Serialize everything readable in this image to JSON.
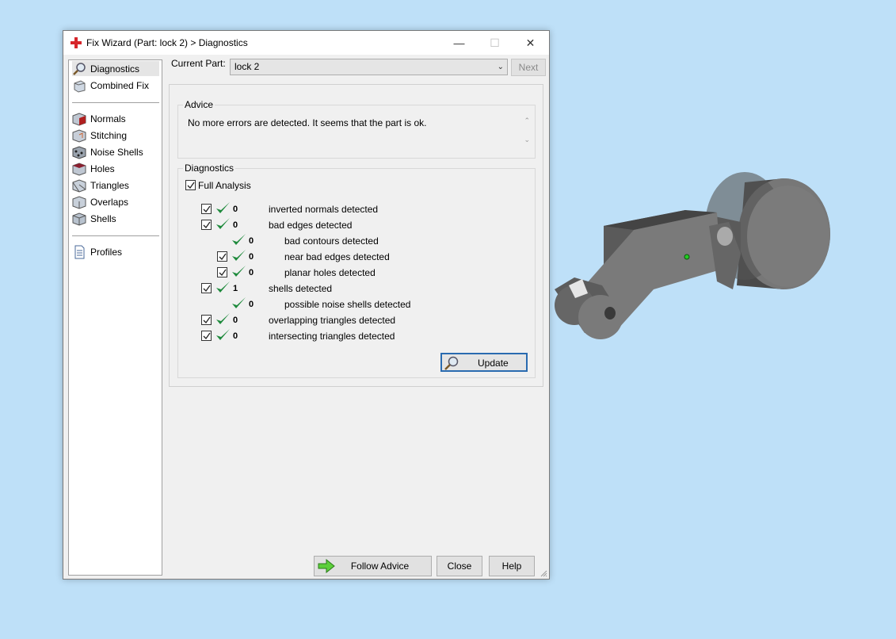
{
  "window": {
    "title": "Fix Wizard (Part: lock 2) > Diagnostics",
    "minimize_glyph": "—",
    "maximize_glyph": "☐",
    "close_glyph": "✕"
  },
  "nav": {
    "items": [
      {
        "label": "Diagnostics",
        "icon": "magnifier-icon"
      },
      {
        "label": "Combined Fix",
        "icon": "combined-fix-icon"
      },
      {
        "label": "Normals",
        "icon": "normals-cube-icon"
      },
      {
        "label": "Stitching",
        "icon": "stitching-cube-icon"
      },
      {
        "label": "Noise Shells",
        "icon": "noise-shells-icon"
      },
      {
        "label": "Holes",
        "icon": "holes-cube-icon"
      },
      {
        "label": "Triangles",
        "icon": "triangles-cube-icon"
      },
      {
        "label": "Overlaps",
        "icon": "overlaps-cube-icon"
      },
      {
        "label": "Shells",
        "icon": "shells-cube-icon"
      },
      {
        "label": "Profiles",
        "icon": "document-icon"
      }
    ],
    "selected": "Diagnostics"
  },
  "current_part": {
    "label": "Current Part:",
    "value": "lock 2",
    "next_label": "Next"
  },
  "advice": {
    "title": "Advice",
    "text": "No more errors are detected. It seems that the part is ok."
  },
  "diagnostics": {
    "title": "Diagnostics",
    "full_analysis_label": "Full Analysis",
    "full_analysis_checked": true,
    "rows": [
      {
        "count": "0",
        "label": "inverted normals detected",
        "checkbox": true,
        "indent": 0
      },
      {
        "count": "0",
        "label": "bad edges detected",
        "checkbox": true,
        "indent": 0
      },
      {
        "count": "0",
        "label": "bad contours detected",
        "checkbox": false,
        "indent": 1
      },
      {
        "count": "0",
        "label": "near bad edges detected",
        "checkbox": true,
        "indent": 1
      },
      {
        "count": "0",
        "label": "planar holes detected",
        "checkbox": true,
        "indent": 1
      },
      {
        "count": "1",
        "label": "shells detected",
        "checkbox": true,
        "indent": 0
      },
      {
        "count": "0",
        "label": "possible noise shells detected",
        "checkbox": false,
        "indent": 1
      },
      {
        "count": "0",
        "label": "overlapping triangles detected",
        "checkbox": true,
        "indent": 0
      },
      {
        "count": "0",
        "label": "intersecting triangles detected",
        "checkbox": true,
        "indent": 0
      }
    ],
    "update_label": "Update"
  },
  "footer": {
    "follow_advice_label": "Follow Advice",
    "close_label": "Close",
    "help_label": "Help"
  },
  "colors": {
    "accent": "#2a6bb0",
    "check_green": "#1e8a3c",
    "background": "#bee0f8"
  }
}
